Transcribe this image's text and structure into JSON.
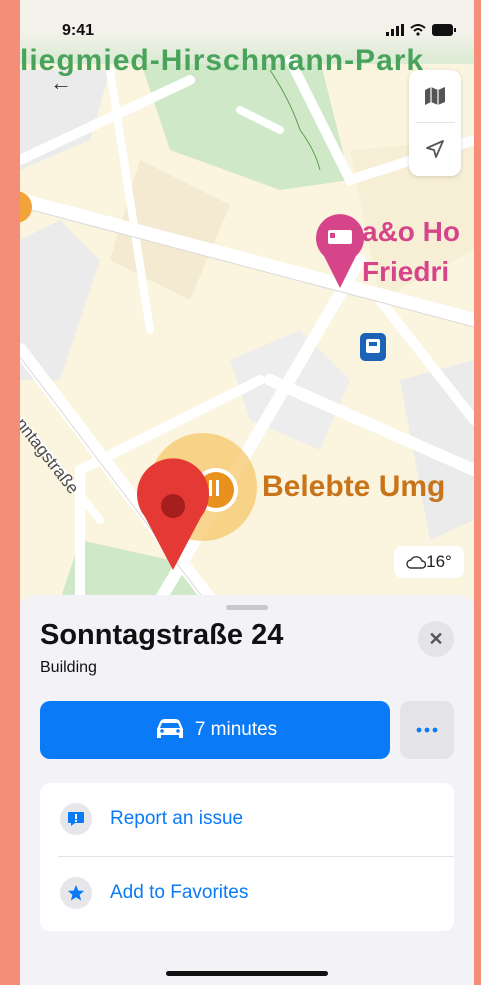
{
  "status_bar": {
    "time": "9:41",
    "icons": [
      "signal-icon",
      "wifi-icon",
      "battery-icon"
    ]
  },
  "map": {
    "park_label": "liegmied-Hirschmann-Park",
    "hotel_label_line1": "a&o Ho",
    "hotel_label_line2": "Friedri",
    "street_label": "Sonntagstraße",
    "poi_label": "Belebte Umg",
    "weather": "16°",
    "controls": [
      "map-mode-icon",
      "location-arrow-icon"
    ]
  },
  "sheet": {
    "title": "Sonntagstraße 24",
    "subtitle": "Building",
    "route_button_label": "7 minutes",
    "actions": [
      {
        "label": "Report an issue",
        "icon": "exclamation-bubble-icon"
      },
      {
        "label": "Add to Favorites",
        "icon": "star-icon"
      }
    ]
  },
  "colors": {
    "accent": "#0A7AF7",
    "frame": "#F58E79",
    "hotel": "#D6458A",
    "poi": "#C8741A",
    "park": "#49A35B",
    "pin": "#E53935"
  }
}
